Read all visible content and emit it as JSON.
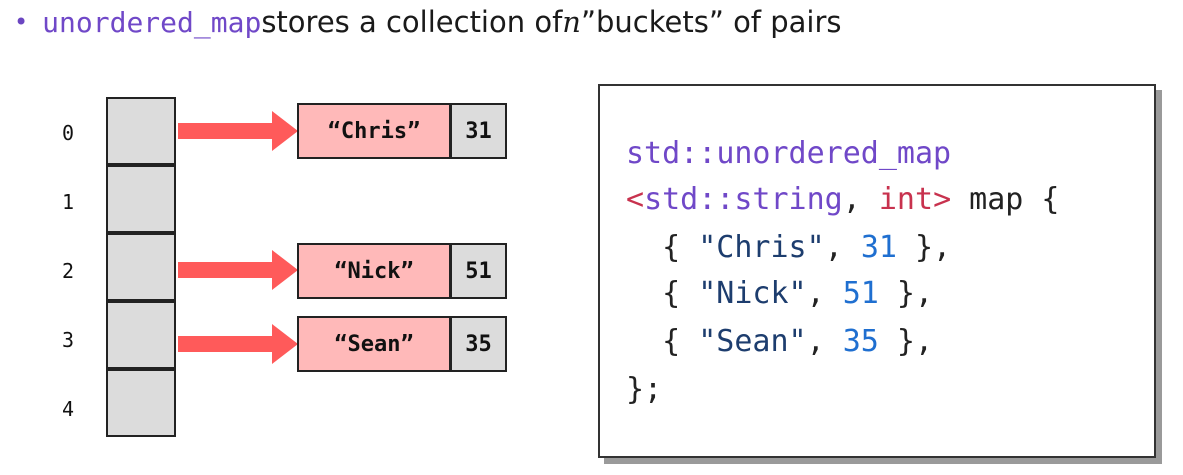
{
  "bullet": {
    "dot": "•",
    "code": "unordered_map",
    "text_before_var": " stores a collection of ",
    "var": "n",
    "text_after_var": " ”buckets” of pairs"
  },
  "buckets": [
    {
      "index": "0"
    },
    {
      "index": "1"
    },
    {
      "index": "2"
    },
    {
      "index": "3"
    },
    {
      "index": "4"
    }
  ],
  "entries": [
    {
      "bucket": 0,
      "key": "“Chris”",
      "value": "31"
    },
    {
      "bucket": 2,
      "key": "“Nick”",
      "value": "51"
    },
    {
      "bucket": 3,
      "key": "“Sean”",
      "value": "35"
    }
  ],
  "code": {
    "l1_ns": "std::",
    "l1_type": "unordered_map",
    "l2_lt": "<",
    "l2_ns": "std::",
    "l2_type": "string",
    "l2_comma": ", ",
    "l2_int": "int",
    "l2_gt": ">",
    "l2_rest": " map {",
    "l3_open": "  { ",
    "l3_str": "\"Chris\"",
    "l3_comma": ", ",
    "l3_num": "31",
    "l3_close": " },",
    "l4_open": "  { ",
    "l4_str": "\"Nick\"",
    "l4_comma": ", ",
    "l4_num": "51",
    "l4_close": " },",
    "l5_open": "  { ",
    "l5_str": "\"Sean\"",
    "l5_comma": ", ",
    "l5_num": "35",
    "l5_close": " },",
    "l6": "};"
  },
  "colors": {
    "bucket_fill": "#dcdcdc",
    "key_fill": "#ffb9b9",
    "arrow": "#ff5a5a",
    "keyword_purple": "#7048c8",
    "type_red": "#c8324e",
    "number_blue": "#1f6fd0"
  }
}
